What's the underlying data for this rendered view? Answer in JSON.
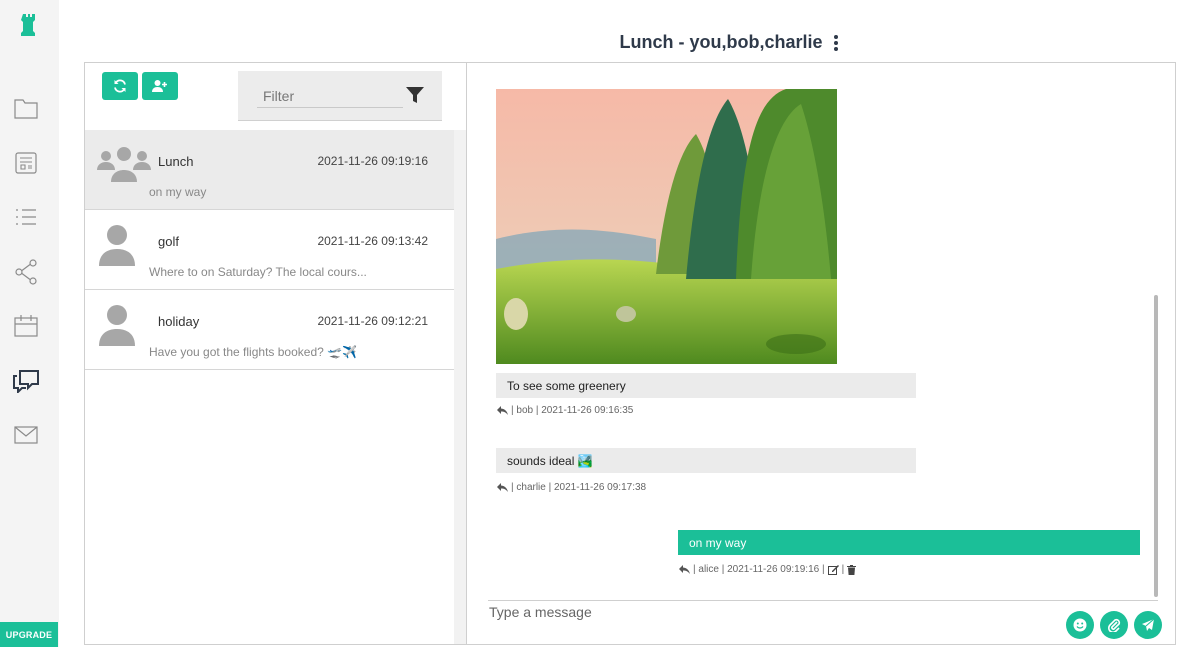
{
  "rail": {
    "upgrade_label": "UPGRADE",
    "items": [
      "folder-icon",
      "document-icon",
      "list-icon",
      "share-icon",
      "calendar-icon",
      "chat-icon",
      "mail-icon"
    ],
    "active_item": "chat-icon"
  },
  "header": {
    "title": "Lunch - you,bob,charlie"
  },
  "toolbar": {
    "filter_placeholder": "Filter"
  },
  "conversations": [
    {
      "name": "Lunch",
      "time": "2021-11-26 09:19:16",
      "preview": "on my way",
      "type": "group",
      "active": true
    },
    {
      "name": "golf",
      "time": "2021-11-26 09:13:42",
      "preview": "Where to on Saturday? The local cours...",
      "type": "single",
      "active": false
    },
    {
      "name": "holiday",
      "time": "2021-11-26 09:12:21",
      "preview": "Have you got the flights booked? 🛫✈️",
      "type": "single",
      "active": false
    }
  ],
  "messages": [
    {
      "text": "To see some greenery",
      "meta": "| bob | 2021-11-26 09:16:35",
      "direction": "in"
    },
    {
      "text": "sounds ideal 🏞️",
      "meta": "| charlie | 2021-11-26 09:17:38",
      "direction": "in"
    },
    {
      "text": "on my way",
      "meta": "| alice | 2021-11-26 09:19:16 |",
      "direction": "out"
    }
  ],
  "composer": {
    "placeholder": "Type a message"
  },
  "colors": {
    "accent": "#1bbf98",
    "title": "#2f3a4a",
    "bubble_in": "#ebebeb"
  }
}
